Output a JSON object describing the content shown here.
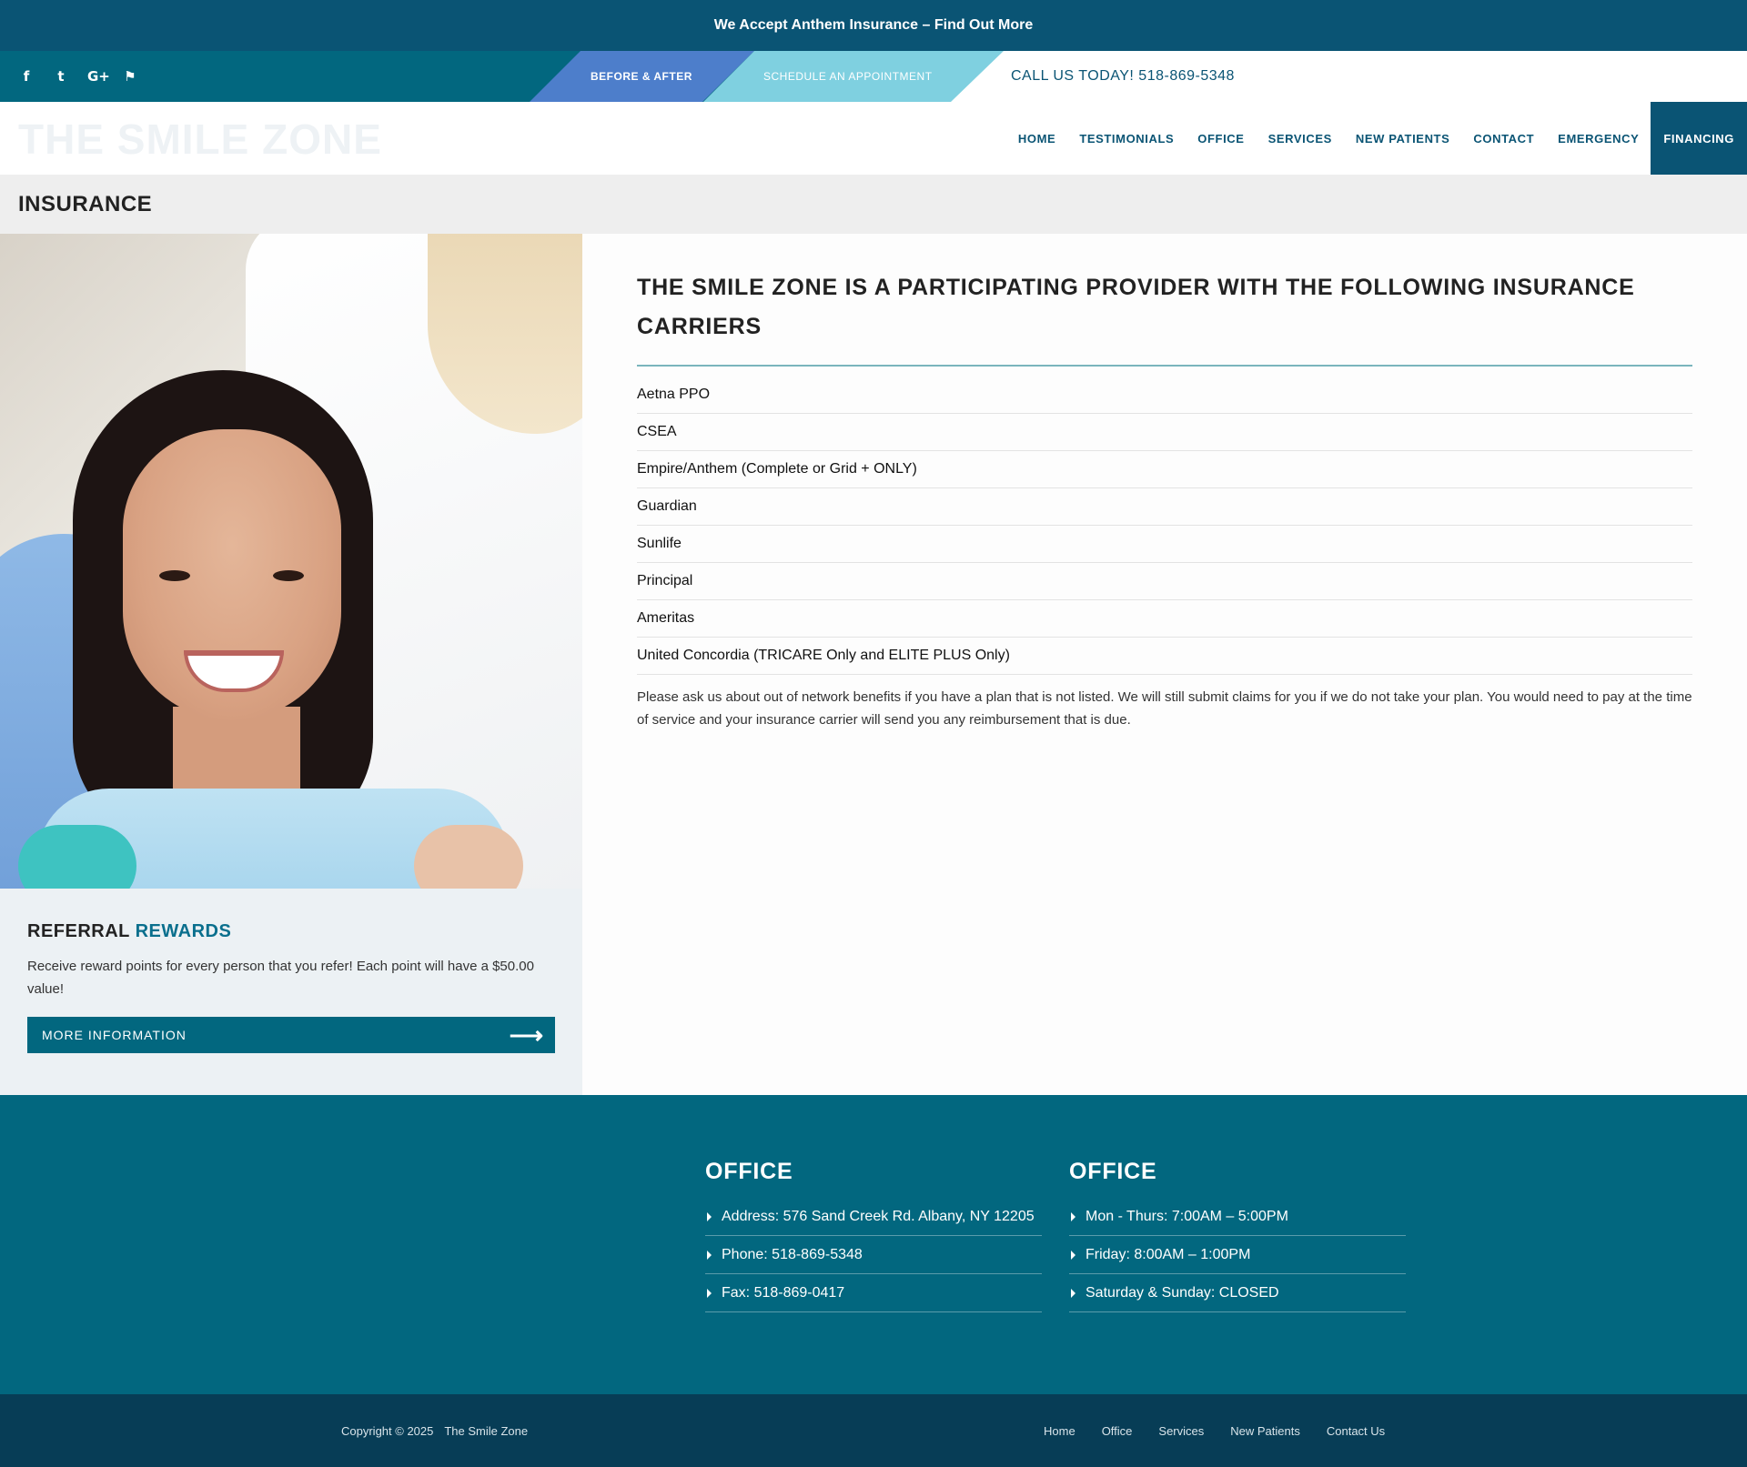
{
  "announcement": {
    "text": "We Accept Anthem Insurance – Find Out More"
  },
  "utility": {
    "social_icons": [
      {
        "name": "facebook-icon",
        "glyph": "f"
      },
      {
        "name": "twitter-icon",
        "glyph": "t"
      },
      {
        "name": "google-plus-icon",
        "glyph": "G+"
      },
      {
        "name": "foursquare-icon",
        "glyph": "⚑"
      }
    ],
    "before_after_label": "Before & After",
    "schedule_label": "Schedule an Appointment",
    "call_text": "CALL US TODAY! 518-869-5348"
  },
  "header": {
    "logo_text": "THE SMILE ZONE",
    "nav": [
      "HOME",
      "TESTIMONIALS",
      "OFFICE",
      "SERVICES",
      "NEW PATIENTS",
      "CONTACT",
      "EMERGENCY",
      "FINANCING"
    ]
  },
  "page": {
    "title": "INSURANCE"
  },
  "referral": {
    "title": "Referral",
    "title_accent": "Rewards",
    "text": "Receive reward points for every person that you refer! Each point will have a $50.00 value!",
    "button_label": "More Information"
  },
  "content": {
    "heading": "THE SMILE ZONE IS A PARTICIPATING PROVIDER WITH THE FOLLOWING INSURANCE CARRIERS",
    "carriers": [
      "Aetna PPO",
      "CSEA",
      "Empire/Anthem (Complete or Grid + ONLY)",
      "Guardian",
      "Sunlife",
      "Principal",
      "Ameritas",
      "United Concordia (TRICARE Only and ELITE PLUS Only)"
    ],
    "note": "Please ask us about out of network benefits if you have a plan that is not listed. We will still submit claims for you if we do not take your plan. You would need to pay at the time of service and your insurance carrier will send you any reimbursement that is due."
  },
  "footer": {
    "office": {
      "title": "OFFICE",
      "items": [
        "Address: 576 Sand Creek Rd. Albany, NY 12205",
        "Phone: 518-869-5348",
        "Fax: 518-869-0417"
      ]
    },
    "hours": {
      "title": "OFFICE",
      "items": [
        "Mon - Thurs: 7:00AM – 5:00PM",
        "Friday: 8:00AM – 1:00PM",
        "Saturday & Sunday: CLOSED"
      ]
    },
    "copyright": "Copyright © 2025",
    "company": "The Smile Zone",
    "links": [
      "Home",
      "Office",
      "Services",
      "New Patients",
      "Contact Us"
    ]
  },
  "colors": {
    "primary": "#02677f",
    "dark": "#0a5474",
    "footer_bottom": "#073d56",
    "before_after_bg": "#4d7ecb",
    "schedule_bg": "#7fd0e0"
  }
}
